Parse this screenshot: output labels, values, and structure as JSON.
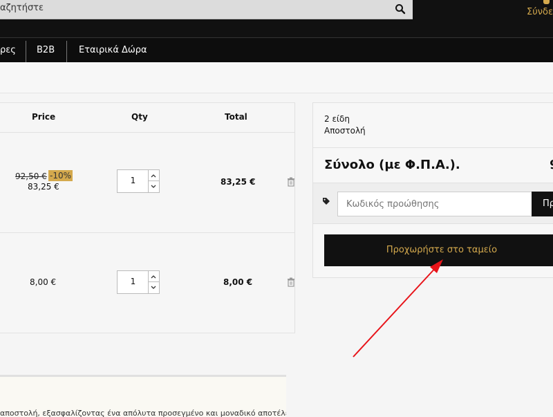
{
  "header": {
    "search_text": "αζητήστε",
    "login_label": "Σύνδε"
  },
  "nav": {
    "items": [
      "ρες",
      "B2B",
      "Εταιρικά Δώρα"
    ]
  },
  "table": {
    "headers": {
      "price": "Price",
      "qty": "Qty",
      "total": "Total"
    },
    "rows": [
      {
        "old_price": "92,50 €",
        "discount": "-10%",
        "price": "83,25 €",
        "qty": "1",
        "total": "83,25 €"
      },
      {
        "price": "8,00 €",
        "qty": "1",
        "total": "8,00 €"
      }
    ]
  },
  "summary": {
    "items_count": "2 είδη",
    "shipping_label": "Αποστολή",
    "total_label": "Σύνολο (με Φ.Π.Α.).",
    "total_value": "9",
    "promo_placeholder": "Κωδικός προώθησης",
    "promo_button": "Πρ",
    "checkout_button": "Προχωρήστε στο ταμείο"
  },
  "bottom": {
    "text": "αποστολή, εξασφαλίζοντας ένα απόλυτα προσεγμένο και μοναδικό αποτέλεσμα"
  },
  "colors": {
    "accent": "#d4a94d",
    "dark": "#111111",
    "annotation_arrow": "#e8141a"
  }
}
